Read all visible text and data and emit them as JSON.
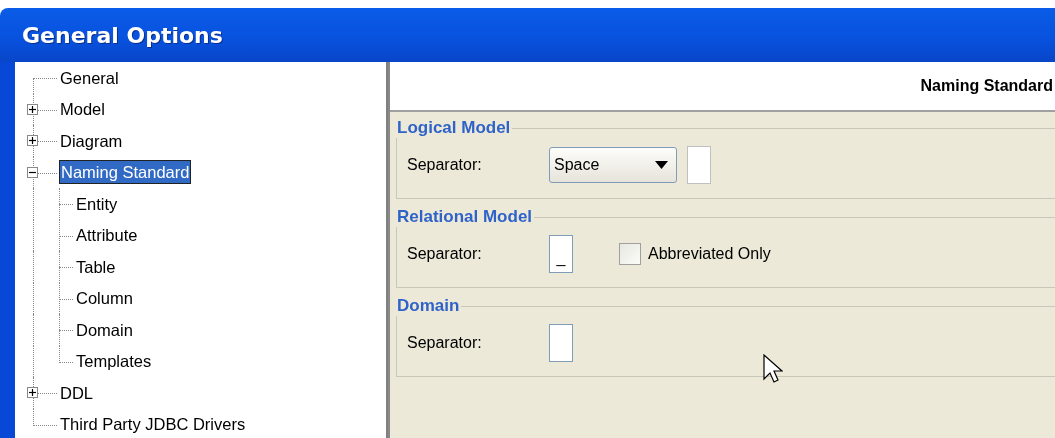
{
  "window": {
    "title": "General Options"
  },
  "tree": [
    {
      "label": "General",
      "kind": "leaf",
      "selected": false
    },
    {
      "label": "Model",
      "kind": "folder",
      "expanded": false,
      "selected": false
    },
    {
      "label": "Diagram",
      "kind": "folder",
      "expanded": false,
      "selected": false
    },
    {
      "label": "Naming Standard",
      "kind": "folder",
      "expanded": true,
      "selected": true,
      "children": [
        {
          "label": "Entity",
          "selected": false
        },
        {
          "label": "Attribute",
          "selected": false
        },
        {
          "label": "Table",
          "selected": false
        },
        {
          "label": "Column",
          "selected": false
        },
        {
          "label": "Domain",
          "selected": false
        },
        {
          "label": "Templates",
          "selected": false
        }
      ]
    },
    {
      "label": "DDL",
      "kind": "folder",
      "expanded": false,
      "selected": false
    },
    {
      "label": "Third Party JDBC Drivers",
      "kind": "leaf",
      "selected": false
    }
  ],
  "panel": {
    "title": "Naming Standard"
  },
  "groups": [
    {
      "title": "Logical Model",
      "label": "Separator:",
      "controls": [
        {
          "kind": "dropdown",
          "value": "Space"
        },
        {
          "kind": "field"
        }
      ]
    },
    {
      "title": "Relational Model",
      "label": "Separator:",
      "controls": [
        {
          "kind": "field",
          "value": "_"
        },
        {
          "kind": "checkbox",
          "label": "Abbreviated Only",
          "checked": false
        }
      ]
    },
    {
      "title": "Domain",
      "label": "Separator:",
      "controls": [
        {
          "kind": "field"
        }
      ]
    }
  ]
}
